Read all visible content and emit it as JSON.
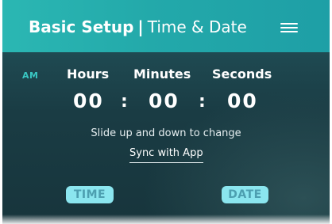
{
  "header": {
    "title_bold": "Basic Setup",
    "separator": "|",
    "title_light": "Time & Date",
    "menu_icon": "hamburger-menu-icon"
  },
  "time": {
    "ampm": "AM",
    "labels": {
      "hours": "Hours",
      "minutes": "Minutes",
      "seconds": "Seconds"
    },
    "values": {
      "hours": "00",
      "minutes": "00",
      "seconds": "00"
    },
    "separator": ":"
  },
  "hint": "Slide up and down to change",
  "sync_label": "Sync with App",
  "buttons": {
    "time": "TIME",
    "date": "DATE"
  },
  "colors": {
    "header": "#23a9aa",
    "panel": "#1a3c44",
    "accent": "#39c6c2",
    "pill": "#8be6ef",
    "pill_text": "#4d9fb0"
  }
}
